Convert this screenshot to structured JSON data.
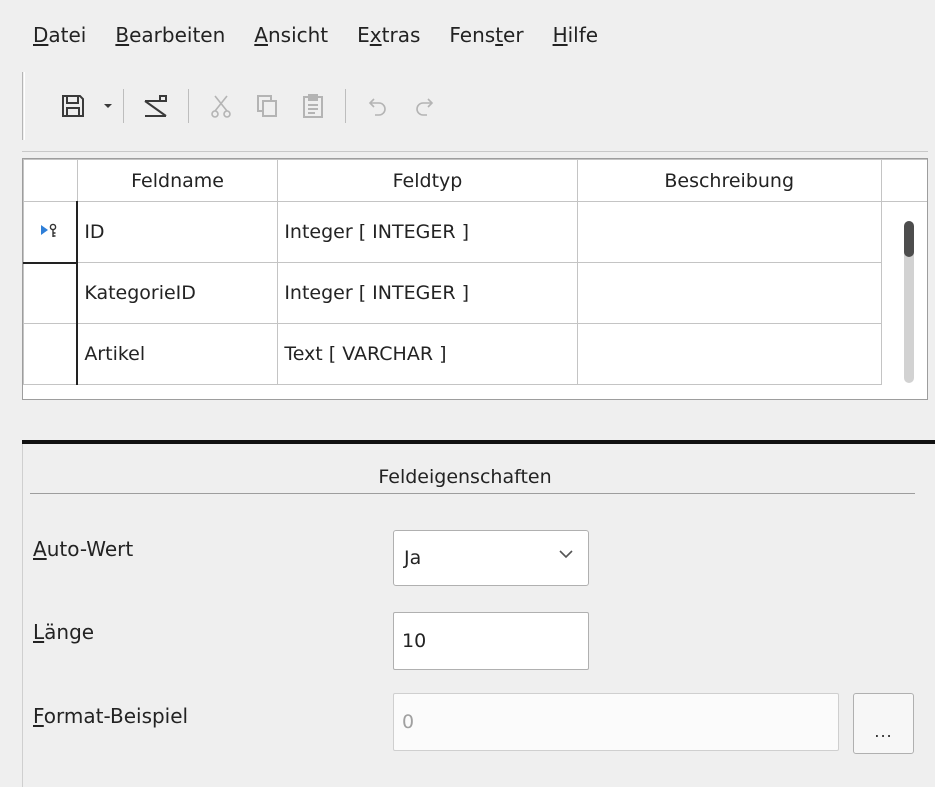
{
  "menu": [
    {
      "pre": "",
      "acc": "D",
      "post": "atei"
    },
    {
      "pre": "",
      "acc": "B",
      "post": "earbeiten"
    },
    {
      "pre": "",
      "acc": "A",
      "post": "nsicht"
    },
    {
      "pre": "E",
      "acc": "x",
      "post": "tras"
    },
    {
      "pre": "Fens",
      "acc": "t",
      "post": "er"
    },
    {
      "pre": "",
      "acc": "H",
      "post": "ilfe"
    }
  ],
  "toolbar": {
    "icons": [
      "save-icon",
      "dropdown-arrow-icon",
      "table-design-icon",
      "cut-icon",
      "copy-icon",
      "paste-icon",
      "undo-icon",
      "redo-icon"
    ]
  },
  "grid": {
    "headers": [
      "Feldname",
      "Feldtyp",
      "Beschreibung"
    ],
    "rows": [
      {
        "name": "ID",
        "type": "Integer [ INTEGER ]",
        "desc": "",
        "primary_key": true,
        "current": true
      },
      {
        "name": "KategorieID",
        "type": "Integer [ INTEGER ]",
        "desc": ""
      },
      {
        "name": "Artikel",
        "type": "Text [ VARCHAR ]",
        "desc": ""
      }
    ]
  },
  "properties": {
    "title": "Feldeigenschaften",
    "auto_value": {
      "acc": "A",
      "rest": "uto-Wert",
      "value": "Ja"
    },
    "length": {
      "acc": "L",
      "rest": "änge",
      "value": "10"
    },
    "format_example": {
      "acc": "F",
      "rest": "ormat-Beispiel",
      "value": "0",
      "button_label": "..."
    }
  },
  "colors": {
    "row_marker": "#2f7fd8",
    "scrollbar_thumb": "#4d4d4d"
  }
}
